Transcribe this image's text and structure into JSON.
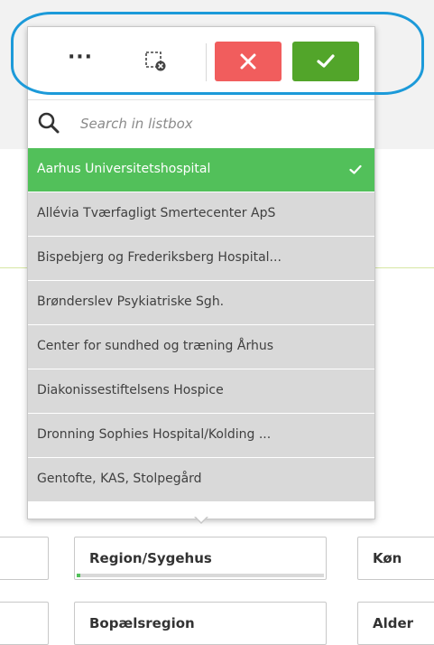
{
  "toolbar": {
    "more_icon": "more-horizontal-icon",
    "clear_icon": "clear-selection-icon",
    "cancel_icon": "close-icon",
    "confirm_icon": "check-icon",
    "colors": {
      "cancel": "#f15d5d",
      "confirm": "#52a52a",
      "selected": "#52c05a"
    }
  },
  "search": {
    "placeholder": "Search in listbox",
    "value": ""
  },
  "listbox": {
    "items": [
      {
        "label": "Aarhus Universitetshospital",
        "selected": true
      },
      {
        "label": "Allévia Tværfagligt Smertecenter ApS",
        "selected": false
      },
      {
        "label": "Bispebjerg og Frederiksberg Hospital...",
        "selected": false
      },
      {
        "label": "Brønderslev Psykiatriske Sgh.",
        "selected": false
      },
      {
        "label": "Center for sundhed og træning Århus",
        "selected": false
      },
      {
        "label": "Diakonissestiftelsens Hospice",
        "selected": false
      },
      {
        "label": "Dronning Sophies Hospital/Kolding ...",
        "selected": false
      },
      {
        "label": "Gentofte, KAS, Stolpegård",
        "selected": false
      }
    ]
  },
  "fields": {
    "region": {
      "label": "Region/Sygehus"
    },
    "kon": {
      "label": "Køn"
    },
    "bopael": {
      "label": "Bopælsregion"
    },
    "alder": {
      "label": "Alder"
    }
  }
}
